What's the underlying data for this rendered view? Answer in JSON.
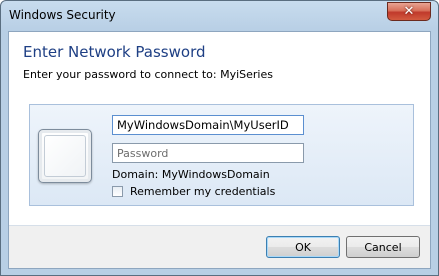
{
  "window": {
    "title": "Windows Security",
    "close_glyph": "✕"
  },
  "header": {
    "title": "Enter Network Password",
    "subtitle": "Enter your password to connect to: MyiSeries"
  },
  "credentials": {
    "user_tile_icon": "user-tile-icon",
    "username_value": "MyWindowsDomain\\MyUserID",
    "password_placeholder": "Password",
    "domain_text": "Domain: MyWindowsDomain",
    "remember_label": "Remember my credentials",
    "remember_checked": false
  },
  "footer": {
    "ok_label": "OK",
    "cancel_label": "Cancel"
  },
  "colors": {
    "header_title": "#1e3f84",
    "close_button": "#c0392b",
    "frame": "#b8cfe5"
  }
}
